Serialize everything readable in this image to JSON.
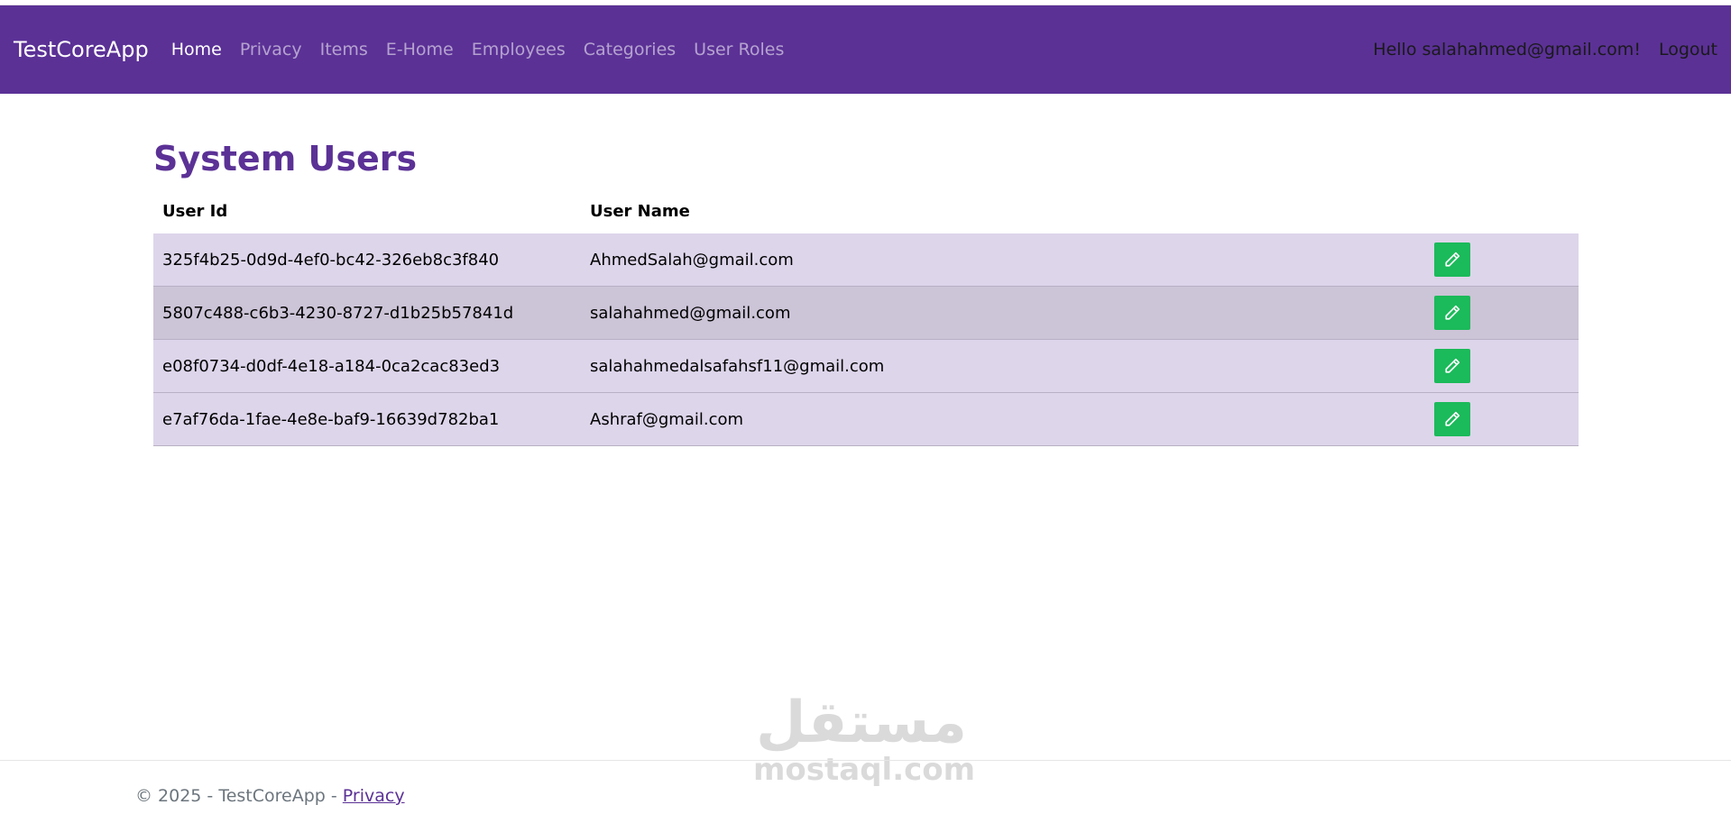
{
  "navbar": {
    "brand": "TestCoreApp",
    "links": [
      {
        "label": "Home"
      },
      {
        "label": "Privacy"
      },
      {
        "label": "Items"
      },
      {
        "label": "E-Home"
      },
      {
        "label": "Employees"
      },
      {
        "label": "Categories"
      },
      {
        "label": "User Roles"
      }
    ],
    "greeting": "Hello salahahmed@gmail.com!",
    "logout": "Logout"
  },
  "main": {
    "title": "System Users",
    "columns": {
      "user_id": "User Id",
      "user_name": "User Name"
    },
    "rows": [
      {
        "id": "325f4b25-0d9d-4ef0-bc42-326eb8c3f840",
        "name": "AhmedSalah@gmail.com"
      },
      {
        "id": "5807c488-c6b3-4230-8727-d1b25b57841d",
        "name": "salahahmed@gmail.com"
      },
      {
        "id": "e08f0734-d0df-4e18-a184-0ca2cac83ed3",
        "name": "salahahmedalsafahsf11@gmail.com"
      },
      {
        "id": "e7af76da-1fae-4e8e-baf9-16639d782ba1",
        "name": "Ashraf@gmail.com"
      }
    ]
  },
  "watermark": {
    "arabic": "مستقل",
    "latin": "mostaql.com"
  },
  "footer": {
    "copyright": "© 2025 - TestCoreApp - ",
    "privacy": "Privacy"
  },
  "colors": {
    "nav_bg": "#5b3196",
    "title": "#5b3196",
    "row_odd": "#ddd5ea",
    "row_even": "#ccc4d7",
    "edit_button": "#1bba5a"
  }
}
